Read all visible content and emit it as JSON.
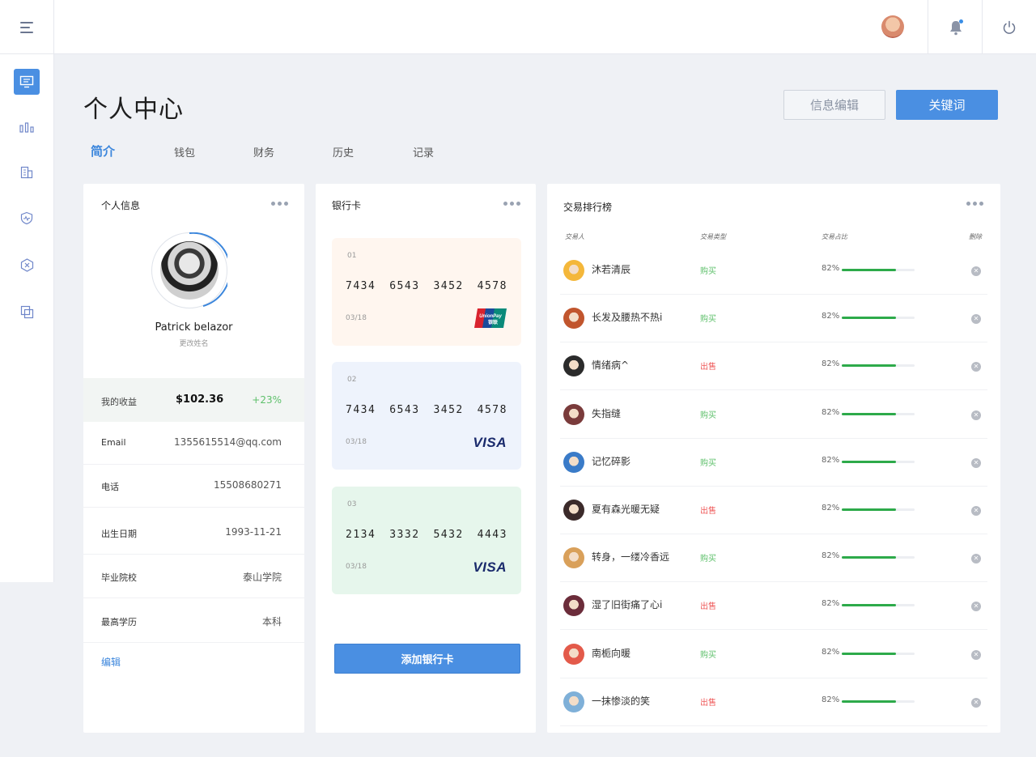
{
  "page": {
    "title": "个人中心",
    "buttons": {
      "edit_info": "信息编辑",
      "keyword": "关键词"
    },
    "tabs": [
      "简介",
      "钱包",
      "财务",
      "历史",
      "记录"
    ]
  },
  "profile_panel": {
    "title": "个人信息",
    "name": "Patrick belazor",
    "subtitle": "更改姓名",
    "income": {
      "label": "我的收益",
      "value": "$102.36",
      "delta": "+23%"
    },
    "fields": [
      {
        "label": "Email",
        "value": "1355615514@qq.com"
      },
      {
        "label": "电话",
        "value": "15508680271"
      },
      {
        "label": "出生日期",
        "value": "1993-11-21"
      },
      {
        "label": "毕业院校",
        "value": "泰山学院"
      },
      {
        "label": "最高学历",
        "value": "本科"
      }
    ],
    "edit_label": "编辑"
  },
  "bank_panel": {
    "title": "银行卡",
    "cards": [
      {
        "index": "01",
        "number": [
          "7434",
          "6543",
          "3452",
          "4578"
        ],
        "expiry": "03/18",
        "brand": "UnionPay 银联",
        "bg": "#fff6ef"
      },
      {
        "index": "02",
        "number": [
          "7434",
          "6543",
          "3452",
          "4578"
        ],
        "expiry": "03/18",
        "brand": "VISA",
        "bg": "#eef3fc"
      },
      {
        "index": "03",
        "number": [
          "2134",
          "3332",
          "5432",
          "4443"
        ],
        "expiry": "03/18",
        "brand": "VISA",
        "bg": "#e6f6ec"
      }
    ],
    "add_button": "添加银行卡"
  },
  "ranking_panel": {
    "title": "交易排行榜",
    "headers": {
      "trader": "交易人",
      "type": "交易类型",
      "ratio": "交易占比",
      "delete": "删除"
    },
    "rows": [
      {
        "name": "沐若清辰",
        "type": "购买",
        "kind": "buy",
        "pct": "82%",
        "ratio": 0.74,
        "avatar_color": "#f4b73a"
      },
      {
        "name": "长发及腰热不热i",
        "type": "购买",
        "kind": "buy",
        "pct": "82%",
        "ratio": 0.74,
        "avatar_color": "#c1552d"
      },
      {
        "name": "情绪病^",
        "type": "出售",
        "kind": "sell",
        "pct": "82%",
        "ratio": 0.74,
        "avatar_color": "#2b2b2b"
      },
      {
        "name": "失指缝",
        "type": "购买",
        "kind": "buy",
        "pct": "82%",
        "ratio": 0.74,
        "avatar_color": "#7a3b3b"
      },
      {
        "name": "记忆碎影",
        "type": "购买",
        "kind": "buy",
        "pct": "82%",
        "ratio": 0.74,
        "avatar_color": "#3a7bc8"
      },
      {
        "name": "夏有森光暖无疑",
        "type": "出售",
        "kind": "sell",
        "pct": "82%",
        "ratio": 0.74,
        "avatar_color": "#3b2a2a"
      },
      {
        "name": "转身，一缕冷香远",
        "type": "购买",
        "kind": "buy",
        "pct": "82%",
        "ratio": 0.74,
        "avatar_color": "#d9a05a"
      },
      {
        "name": "湿了旧街痛了心i",
        "type": "出售",
        "kind": "sell",
        "pct": "82%",
        "ratio": 0.74,
        "avatar_color": "#6b2c3a"
      },
      {
        "name": "南栀向暖",
        "type": "购买",
        "kind": "buy",
        "pct": "82%",
        "ratio": 0.74,
        "avatar_color": "#e35a4a"
      },
      {
        "name": "一抹惨淡的笑",
        "type": "出售",
        "kind": "sell",
        "pct": "82%",
        "ratio": 0.74,
        "avatar_color": "#7fb0d8"
      }
    ]
  },
  "icons": {
    "menu": "menu-icon",
    "bell": "bell-icon",
    "power": "power-icon",
    "nav": [
      "monitor-icon",
      "bar-chart-icon",
      "building-icon",
      "shield-icon",
      "close-circle-icon",
      "copy-icon"
    ]
  },
  "colors": {
    "accent": "#4a8fe2",
    "buy": "#5ec06b",
    "sell": "#ef5a5a",
    "progress": "#2daa4a"
  }
}
